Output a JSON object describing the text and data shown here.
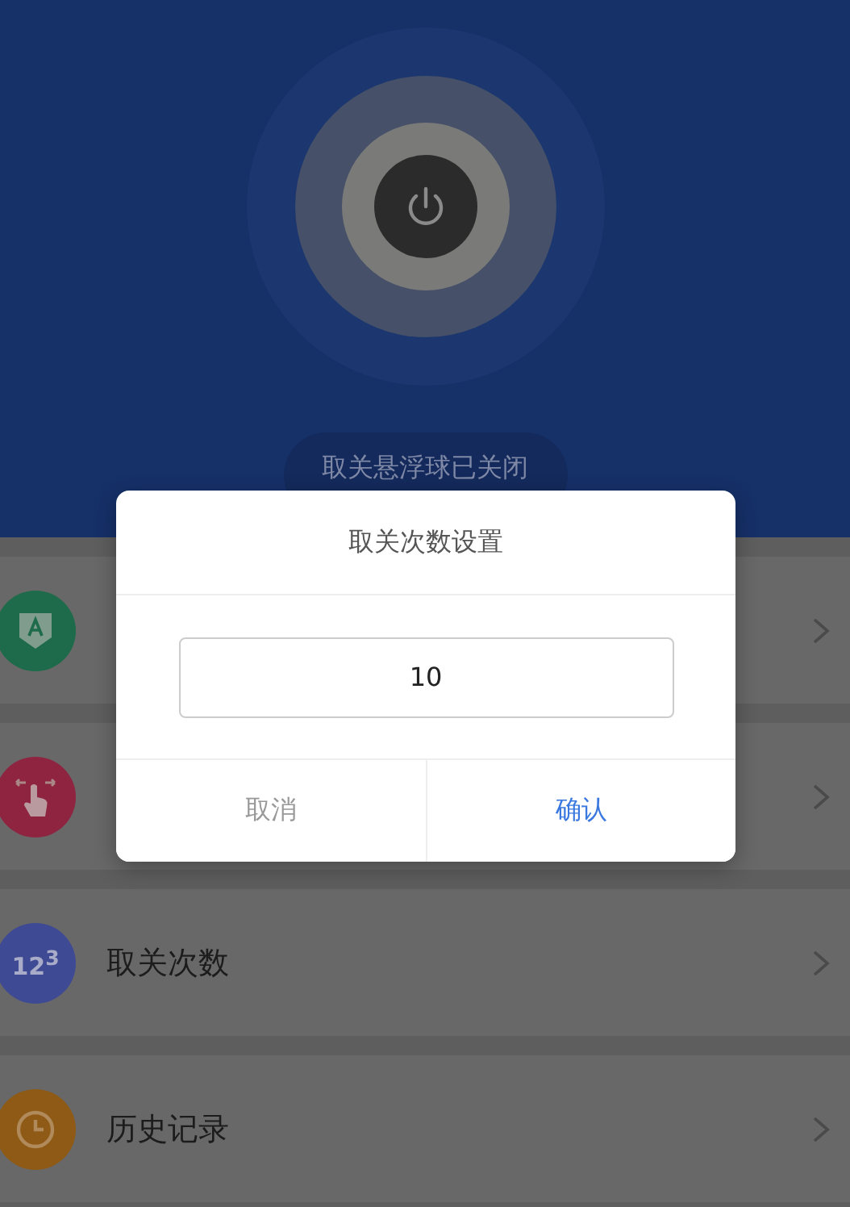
{
  "status": {
    "text": "取关悬浮球已关闭",
    "on": false
  },
  "menu": [
    {
      "kind": "shield",
      "color": "#1d6b4a"
    },
    {
      "kind": "touch",
      "color": "#8e2440"
    },
    {
      "kind": "number",
      "label": "取关次数",
      "icon_text": "12$^{3}$",
      "color": "#3f4a94"
    },
    {
      "kind": "clock",
      "label": "历史记录",
      "color": "#8e5a16"
    }
  ],
  "dialog": {
    "title": "取关次数设置",
    "value": "10",
    "buttons": [
      {
        "label": "取消",
        "kind": "cancel"
      },
      {
        "label": "确认",
        "kind": "confirm"
      }
    ]
  }
}
